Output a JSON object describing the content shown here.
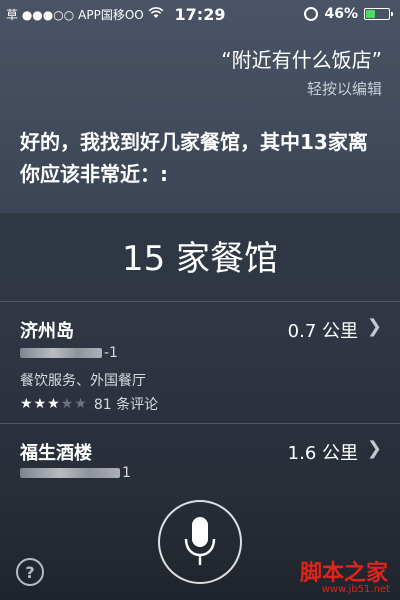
{
  "status_bar": {
    "carrier": "草 ●●●○○",
    "carrier_name": "APP国移OO",
    "wifi_icon": "wifi-icon",
    "time": "17:29",
    "battery_percent": "46%",
    "battery_level": 0.46
  },
  "siri": {
    "query": "“附近有什么饭店”",
    "edit_hint": "轻按以编辑",
    "reply": "好的，我找到好几家餐馆，其中13家离你应该非常近：:"
  },
  "results": {
    "title": "15 家餐馆",
    "items": [
      {
        "name": "济州岛",
        "distance": "0.7 公里",
        "address_suffix": "-1",
        "category": "餐饮服务、外国餐厅",
        "rating": 3,
        "rating_max": 5,
        "reviews": "81 条评论"
      },
      {
        "name": "福生酒楼",
        "distance": "1.6 公里",
        "address_suffix": "1"
      }
    ]
  },
  "controls": {
    "help_label": "?",
    "mic_icon": "microphone-icon"
  },
  "watermark": {
    "text": "脚本之家",
    "url": "www.jb51.net"
  }
}
